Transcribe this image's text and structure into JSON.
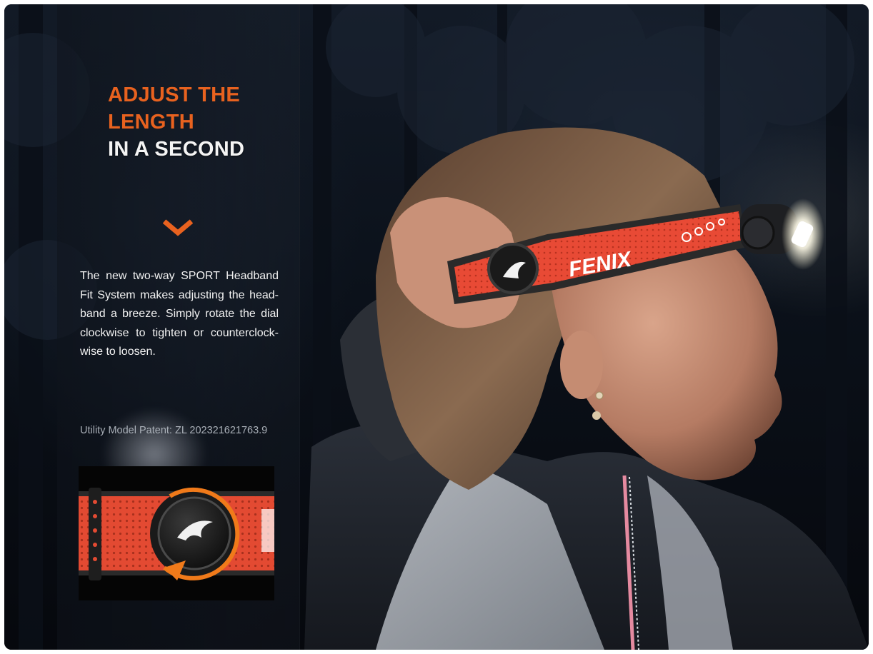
{
  "headline": {
    "line1": "ADJUST THE",
    "line2": "LENGTH",
    "line3": "IN A SECOND"
  },
  "description": "The new two-way SPORT Headband Fit System makes adjusting the head-band a breeze. Simply rotate the dial clockwise to tighten or counterclock-wise to loosen.",
  "patent": "Utility Model Patent: ZL 202321621763.9",
  "headband_brand": "FENIX",
  "icons": [
    "chevron-down-icon",
    "flame-logo-icon"
  ],
  "colors": {
    "accent": "#e8621f",
    "headband": "#e84a35",
    "background": "#070b12"
  }
}
